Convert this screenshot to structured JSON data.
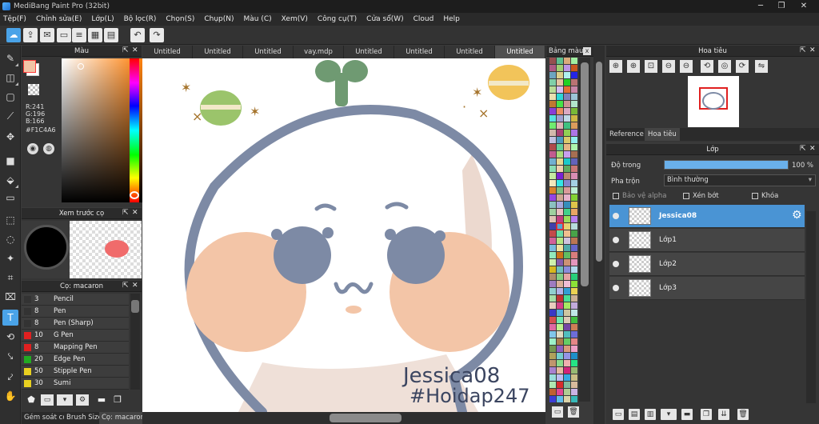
{
  "window": {
    "title": "MediBang Paint Pro (32bit)",
    "minimize": "─",
    "maximize": "❐",
    "close": "✕"
  },
  "menu": [
    "Tệp(F)",
    "Chỉnh sửa(E)",
    "Lớp(L)",
    "Bộ lọc(R)",
    "Chọn(S)",
    "Chụp(N)",
    "Màu (C)",
    "Xem(V)",
    "Công cụ(T)",
    "Cửa sổ(W)",
    "Cloud",
    "Help"
  ],
  "color_panel": {
    "title": "Màu",
    "r": "R:241",
    "g": "G:196",
    "b": "B:166",
    "hex": "#F1C4A6",
    "current_color": "#F1C4A6"
  },
  "brush_preview": {
    "title": "Xem trước cọ"
  },
  "brush_panel": {
    "title": "Cọ: macaron",
    "brushes": [
      {
        "size": "3",
        "name": "Pencil",
        "color": "#333333"
      },
      {
        "size": "8",
        "name": "Pen",
        "color": "#333333"
      },
      {
        "size": "8",
        "name": "Pen (Sharp)",
        "color": "#333333"
      },
      {
        "size": "10",
        "name": "G Pen",
        "color": "#e02020"
      },
      {
        "size": "8",
        "name": "Mapping Pen",
        "color": "#e02020"
      },
      {
        "size": "20",
        "name": "Edge Pen",
        "color": "#22aa22"
      },
      {
        "size": "50",
        "name": "Stipple Pen",
        "color": "#e8d020"
      },
      {
        "size": "30",
        "name": "Sumi",
        "color": "#e8d020"
      }
    ]
  },
  "left_bottom_tabs": [
    "Gém soát cọ",
    "Brush Size",
    "Cọ: macaron"
  ],
  "document_tabs": [
    "Untitled",
    "Untitled",
    "Untitled",
    "vay.mdp",
    "Untitled",
    "Untitled",
    "Untitled",
    "Untitled"
  ],
  "canvas_text": {
    "line1": "Jessica08",
    "line2": "#Hoidap247"
  },
  "palette_panel": {
    "title": "Bảng màu",
    "close": "x"
  },
  "navigator": {
    "title": "Hoa tiêu"
  },
  "reference_tabs": [
    "Reference",
    "Hoa tiêu"
  ],
  "layer_panel": {
    "title": "Lớp",
    "opacity_label": "Độ trong",
    "opacity_value": "100 %",
    "opacity_fraction": 1.0,
    "blend_label": "Pha trộn",
    "blend_value": "Bình thường",
    "protect_alpha": "Bảo vệ alpha",
    "clipping": "Xén bớt",
    "lock": "Khóa",
    "layers": [
      {
        "name": "Jessica08",
        "selected": true
      },
      {
        "name": "Lớp1",
        "selected": false
      },
      {
        "name": "Lớp2",
        "selected": false
      },
      {
        "name": "Lớp3",
        "selected": false
      }
    ]
  },
  "icons": {
    "accent": "#4aa3e8",
    "selected_layer": "#4a94d4"
  }
}
